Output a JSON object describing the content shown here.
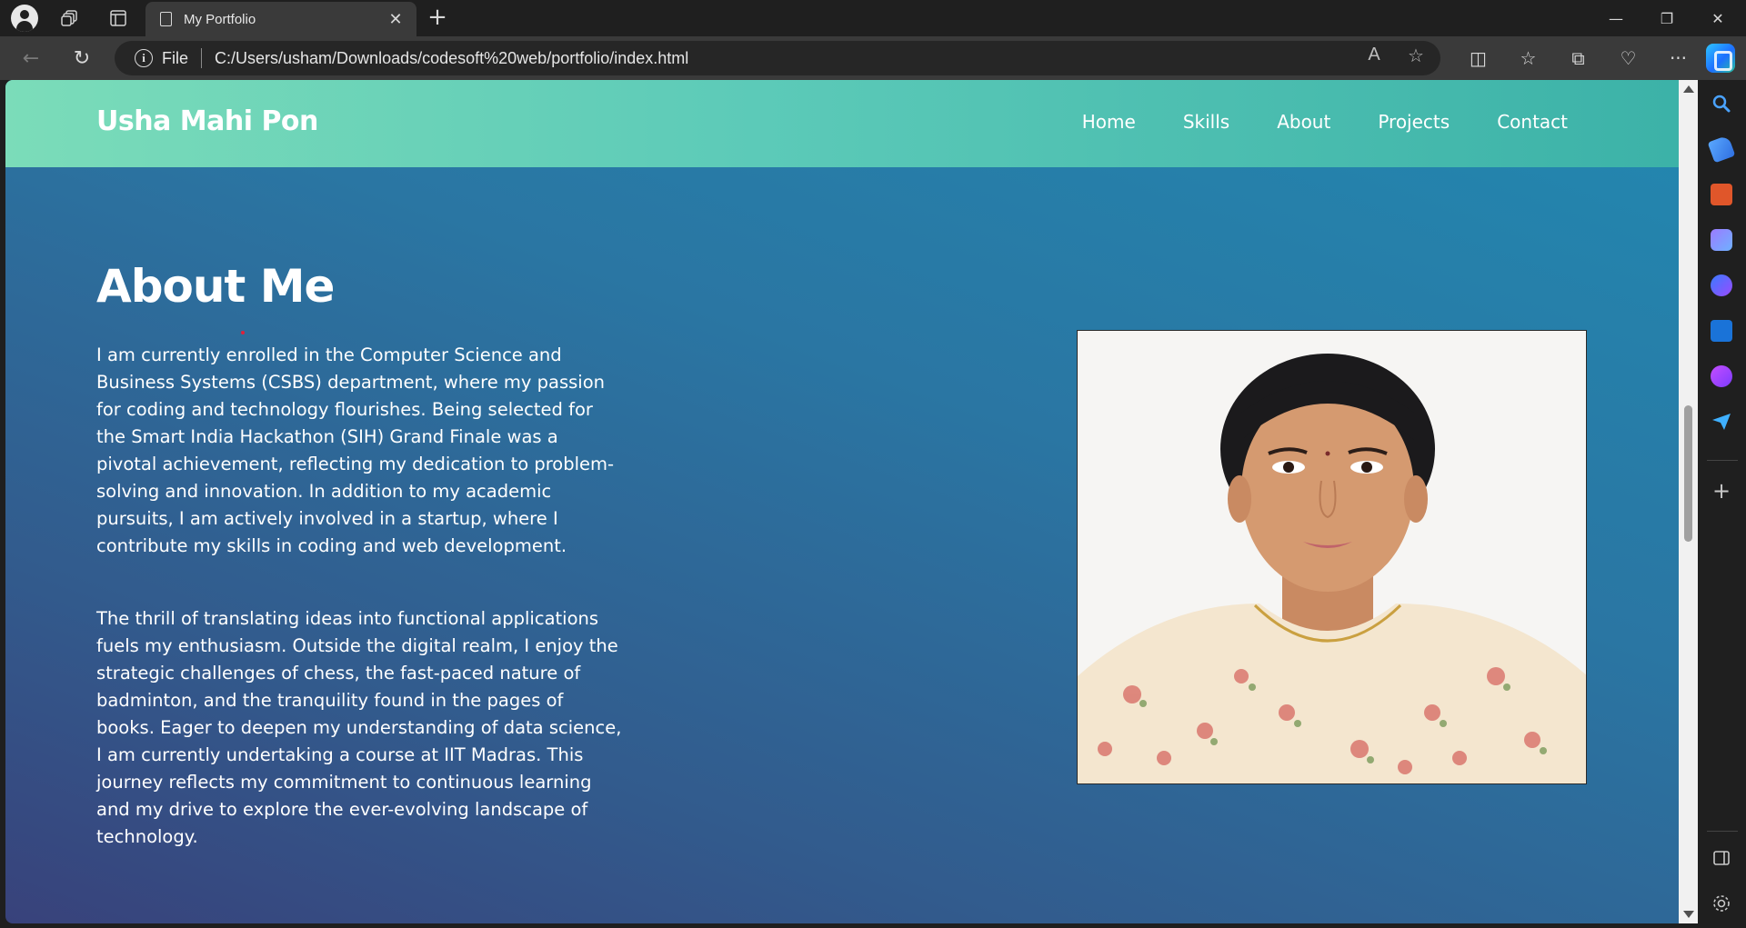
{
  "browser": {
    "tab_title": "My Portfolio",
    "tab_close": "✕",
    "new_tab": "+",
    "file_label": "File",
    "address": "C:/Users/usham/Downloads/codesoft%20web/portfolio/index.html",
    "window": {
      "minimize": "—",
      "restore": "❐",
      "close": "✕"
    },
    "nav": {
      "back": "←",
      "reload": "↻"
    },
    "omnibox_icons": {
      "read_aloud": "A",
      "favorite": "☆"
    },
    "toolbar_icons": {
      "split_screen": "◫",
      "favorites": "☆",
      "collections": "⧉",
      "browser_essentials": "♡",
      "more": "···"
    }
  },
  "site": {
    "brand": "Usha Mahi Pon",
    "nav": [
      "Home",
      "Skills",
      "About",
      "Projects",
      "Contact"
    ],
    "about": {
      "title": "About Me",
      "paragraphs": [
        "I am currently enrolled in the Computer Science and Business Systems (CSBS) department, where my passion for coding and technology flourishes. Being selected for the Smart India Hackathon (SIH) Grand Finale was a pivotal achievement, reflecting my dedication to problem-solving and innovation. In addition to my academic pursuits, I am actively involved in a startup, where I contribute my skills in coding and web development.",
        "The thrill of translating ideas into functional applications fuels my enthusiasm. Outside the digital realm, I enjoy the strategic challenges of chess, the fast-paced nature of badminton, and the tranquility found in the pages of books. Eager to deepen my understanding of data science, I am currently undertaking a course at IIT Madras. This journey reflects my commitment to continuous learning and my drive to explore the ever-evolving landscape of technology."
      ]
    }
  },
  "colors": {
    "header_gradient_start": "#7bdcb9",
    "header_gradient_end": "#3cb2a8",
    "page_gradient_top": "#2288b0",
    "page_gradient_bottom": "#38427b"
  }
}
